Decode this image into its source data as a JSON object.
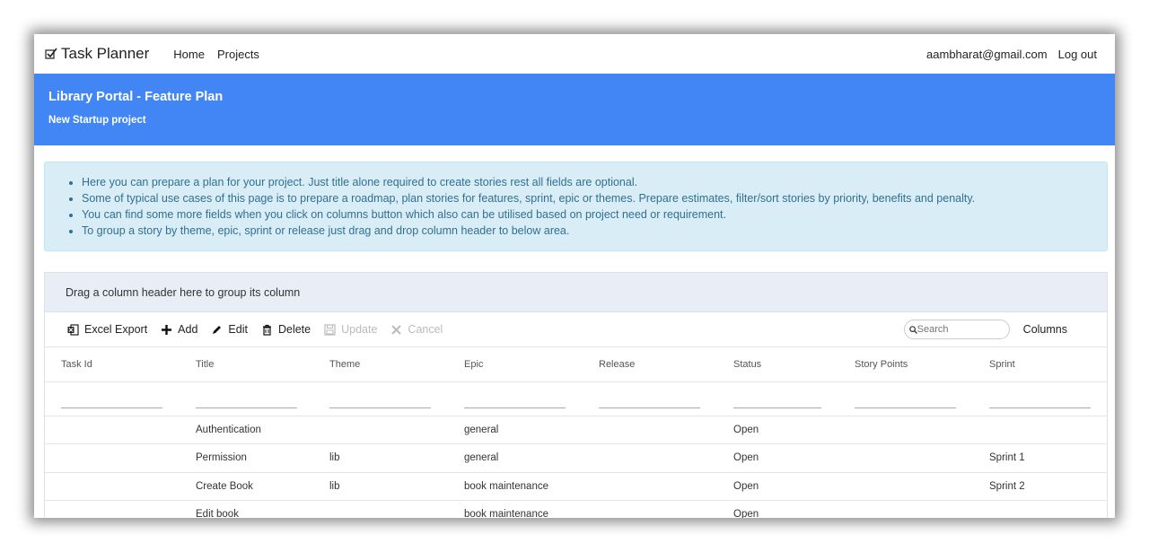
{
  "navbar": {
    "brand": "Task Planner",
    "links": [
      "Home",
      "Projects"
    ],
    "user_email": "aambharat@gmail.com",
    "logout": "Log out"
  },
  "banner": {
    "title": "Library Portal - Feature Plan",
    "subtitle": "New Startup project"
  },
  "info": {
    "items": [
      "Here you can prepare a plan for your project. Just title alone required to create stories rest all fields are optional.",
      "Some of typical use cases of this page is to prepare a roadmap, plan stories for features, sprint, epic or themes. Prepare estimates, filter/sort stories by priority, benefits and penalty.",
      "You can find some more fields when you click on columns button which also can be utilised based on project need or requirement.",
      "To group a story by theme, epic, sprint or release just drag and drop column header to below area."
    ]
  },
  "grid": {
    "group_hint": "Drag a column header here to group its column",
    "toolbar": {
      "excel": "Excel Export",
      "add": "Add",
      "edit": "Edit",
      "delete": "Delete",
      "update": "Update",
      "cancel": "Cancel",
      "search_placeholder": "Search",
      "columns": "Columns"
    },
    "headers": [
      "Task Id",
      "Title",
      "Theme",
      "Epic",
      "Release",
      "Status",
      "Story Points",
      "Sprint"
    ],
    "rows": [
      [
        "",
        "Authentication",
        "",
        "general",
        "",
        "Open",
        "",
        ""
      ],
      [
        "",
        "Permission",
        "lib",
        "general",
        "",
        "Open",
        "",
        "Sprint 1"
      ],
      [
        "",
        "Create Book",
        "lib",
        "book maintenance",
        "",
        "Open",
        "",
        "Sprint 2"
      ],
      [
        "",
        "Edit book",
        "",
        "book maintenance",
        "",
        "Open",
        "",
        ""
      ]
    ]
  },
  "colors": {
    "banner": "#4285f4",
    "info_bg": "#d9edf7",
    "info_text": "#31708f",
    "group_area": "#e9edf5"
  }
}
